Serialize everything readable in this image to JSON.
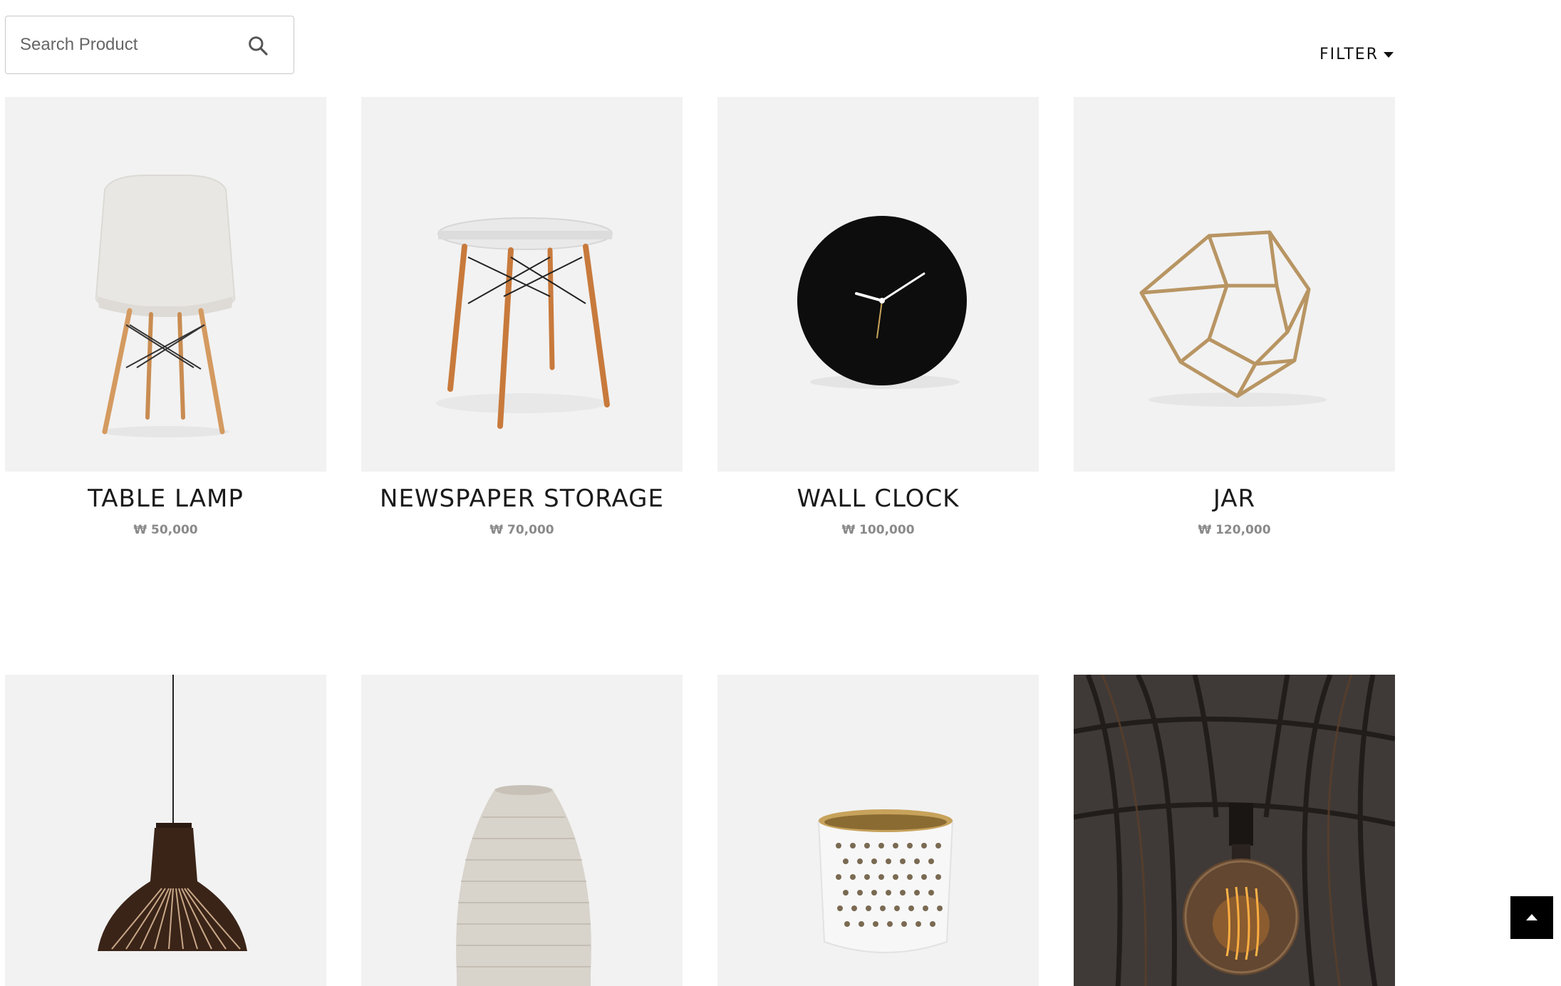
{
  "search": {
    "placeholder": "Search Product",
    "value": ""
  },
  "filter": {
    "label": "FILTER"
  },
  "products": [
    {
      "title": "TABLE LAMP",
      "price": "₩ 50,000",
      "image": "chair"
    },
    {
      "title": "NEWSPAPER STORAGE",
      "price": "₩ 70,000",
      "image": "stool"
    },
    {
      "title": "WALL CLOCK",
      "price": "₩ 100,000",
      "image": "clock"
    },
    {
      "title": "JAR",
      "price": "₩ 120,000",
      "image": "geometric-frame"
    },
    {
      "title": "",
      "price": "",
      "image": "pendant-lamp"
    },
    {
      "title": "",
      "price": "",
      "image": "vase"
    },
    {
      "title": "",
      "price": "",
      "image": "cup"
    },
    {
      "title": "",
      "price": "",
      "image": "edison-bulb"
    }
  ],
  "colors": {
    "tile_background": "#f2f2f2",
    "price": "#8a8a8a",
    "scroll_top_background": "#000000"
  },
  "icons": {
    "search": "search-icon",
    "filter_caret": "caret-down-icon",
    "scroll_top": "arrow-up-icon"
  }
}
